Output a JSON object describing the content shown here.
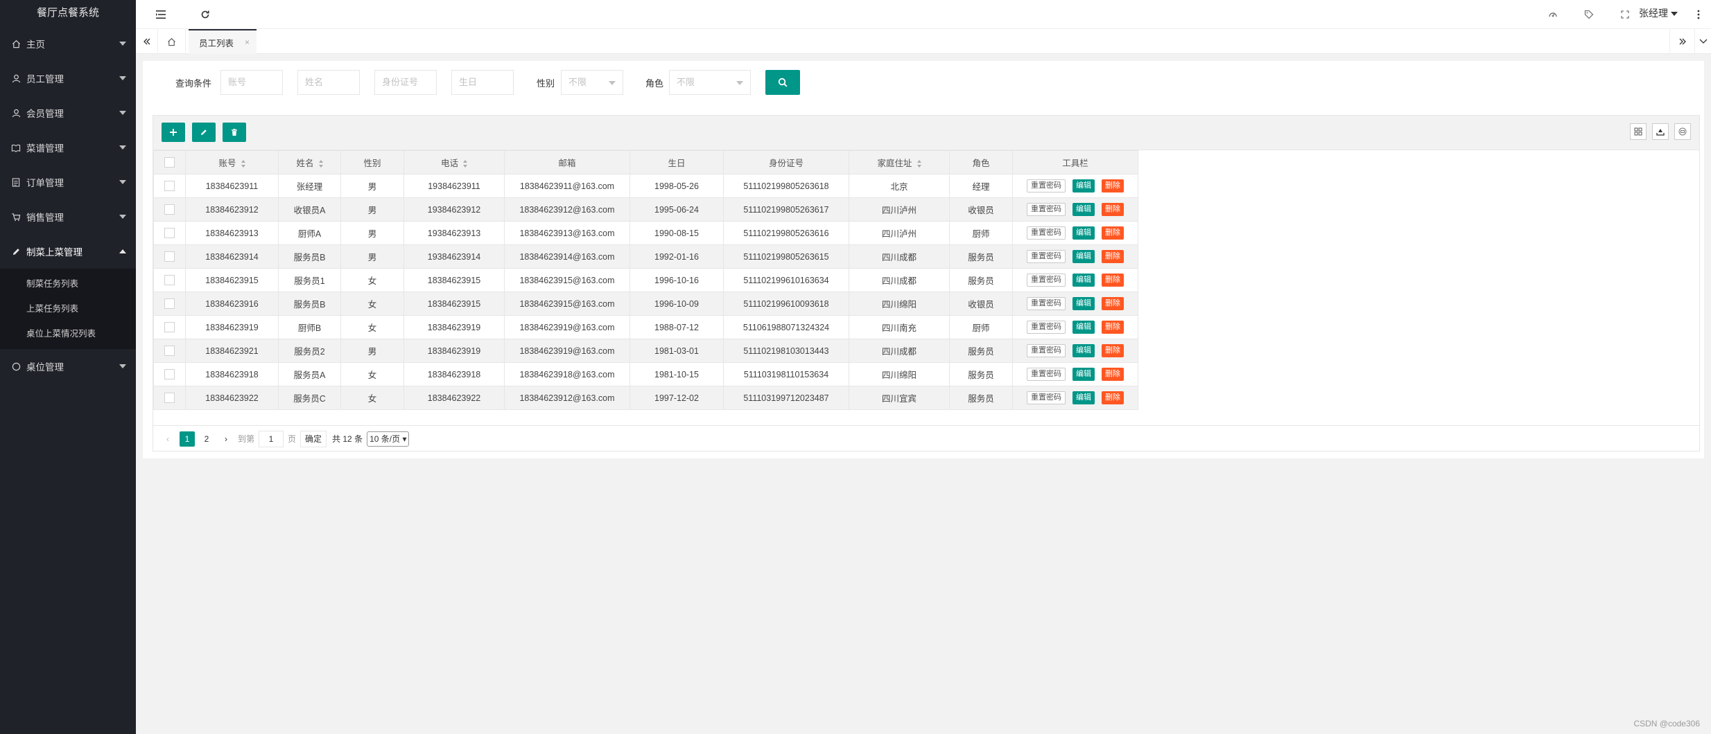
{
  "app": {
    "title": "餐厅点餐系统"
  },
  "sidebar": {
    "items": [
      {
        "label": "主页",
        "icon": "home-icon"
      },
      {
        "label": "员工管理",
        "icon": "user-icon"
      },
      {
        "label": "会员管理",
        "icon": "user-icon"
      },
      {
        "label": "菜谱管理",
        "icon": "book-icon"
      },
      {
        "label": "订单管理",
        "icon": "list-icon"
      },
      {
        "label": "销售管理",
        "icon": "cart-icon"
      },
      {
        "label": "制菜上菜管理",
        "icon": "edit-icon"
      },
      {
        "label": "桌位管理",
        "icon": "circle-icon"
      }
    ],
    "submenu": [
      "制菜任务列表",
      "上菜任务列表",
      "桌位上菜情况列表"
    ]
  },
  "header": {
    "user": "张经理"
  },
  "tabs": {
    "current": "员工列表"
  },
  "search": {
    "label": "查询条件",
    "account_placeholder": "账号",
    "name_placeholder": "姓名",
    "id_placeholder": "身份证号",
    "birthday_placeholder": "生日",
    "gender_label": "性别",
    "gender_value": "不限",
    "role_label": "角色",
    "role_value": "不限"
  },
  "table": {
    "columns": [
      "账号",
      "姓名",
      "性别",
      "电话",
      "邮箱",
      "生日",
      "身份证号",
      "家庭住址",
      "角色",
      "工具栏"
    ],
    "actions": {
      "reset": "重置密码",
      "edit": "编辑",
      "delete": "删除"
    },
    "rows": [
      [
        "18384623911",
        "张经理",
        "男",
        "19384623911",
        "18384623911@163.com",
        "1998-05-26",
        "511102199805263618",
        "北京",
        "经理"
      ],
      [
        "18384623912",
        "收银员A",
        "男",
        "19384623912",
        "18384623912@163.com",
        "1995-06-24",
        "511102199805263617",
        "四川泸州",
        "收银员"
      ],
      [
        "18384623913",
        "厨师A",
        "男",
        "19384623913",
        "18384623913@163.com",
        "1990-08-15",
        "511102199805263616",
        "四川泸州",
        "厨师"
      ],
      [
        "18384623914",
        "服务员B",
        "男",
        "19384623914",
        "18384623914@163.com",
        "1992-01-16",
        "511102199805263615",
        "四川成都",
        "服务员"
      ],
      [
        "18384623915",
        "服务员1",
        "女",
        "18384623915",
        "18384623915@163.com",
        "1996-10-16",
        "511102199610163634",
        "四川成都",
        "服务员"
      ],
      [
        "18384623916",
        "服务员B",
        "女",
        "18384623915",
        "18384623915@163.com",
        "1996-10-09",
        "511102199610093618",
        "四川绵阳",
        "收银员"
      ],
      [
        "18384623919",
        "厨师B",
        "女",
        "18384623919",
        "18384623919@163.com",
        "1988-07-12",
        "511061988071324324",
        "四川南充",
        "厨师"
      ],
      [
        "18384623921",
        "服务员2",
        "男",
        "18384623919",
        "18384623919@163.com",
        "1981-03-01",
        "511102198103013443",
        "四川成都",
        "服务员"
      ],
      [
        "18384623918",
        "服务员A",
        "女",
        "18384623918",
        "18384623918@163.com",
        "1981-10-15",
        "511103198110153634",
        "四川绵阳",
        "服务员"
      ],
      [
        "18384623922",
        "服务员C",
        "女",
        "18384623922",
        "18384623912@163.com",
        "1997-12-02",
        "511103199712023487",
        "四川宜宾",
        "服务员"
      ]
    ]
  },
  "pagination": {
    "pages": [
      "1",
      "2"
    ],
    "goto_label": "到第",
    "page_input": "1",
    "page_unit": "页",
    "confirm": "确定",
    "total": "共 12 条",
    "page_size": "10 条/页"
  },
  "watermark": "CSDN @code306"
}
